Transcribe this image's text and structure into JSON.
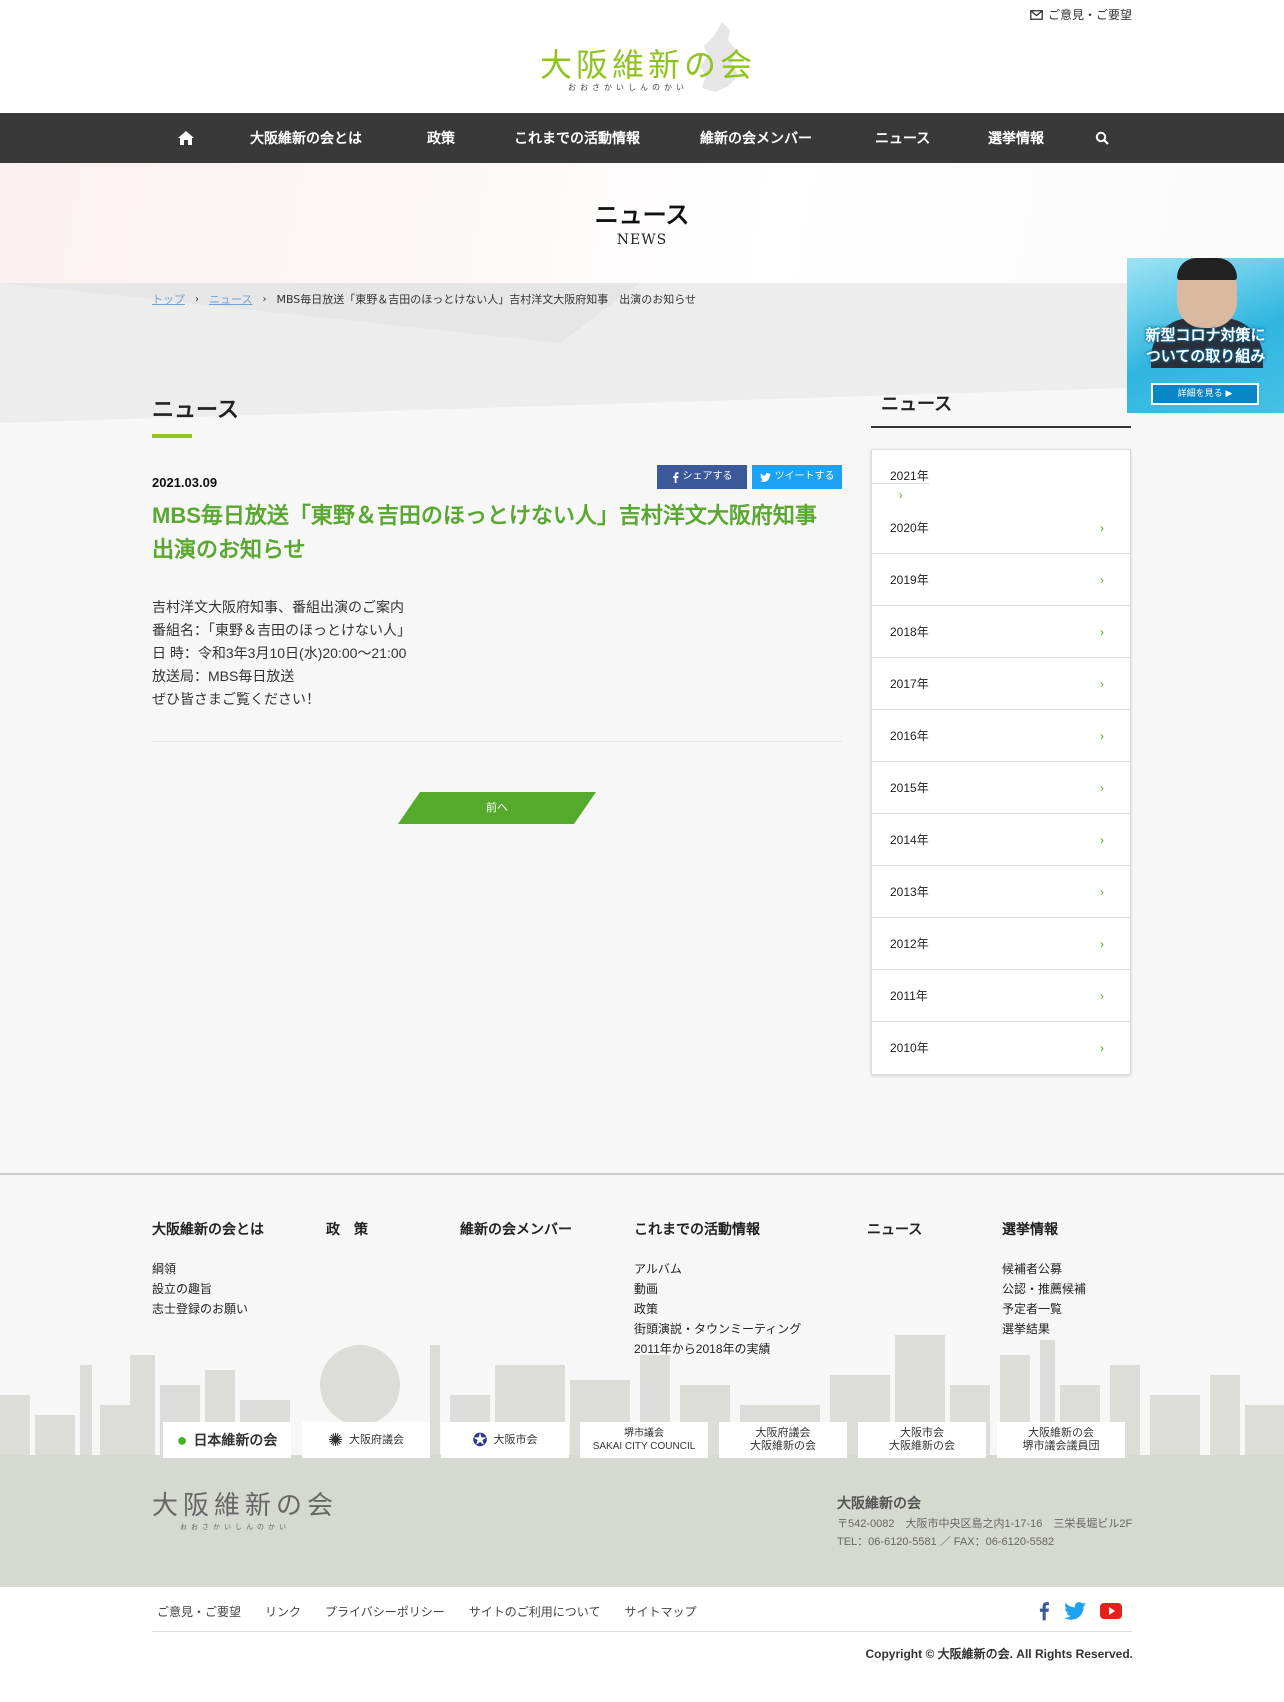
{
  "header": {
    "logo_text": "大阪維新の会",
    "logo_sub": "おおさかいしんのかい",
    "contact_label": "ご意見・ご要望"
  },
  "nav": {
    "items": [
      "大阪維新の会とは",
      "政策",
      "これまでの活動情報",
      "維新の会メンバー",
      "ニュース",
      "選挙情報"
    ]
  },
  "page": {
    "title": "ニュース",
    "subtitle": "NEWS"
  },
  "breadcrumb": [
    "トップ",
    "ニュース",
    "MBS毎日放送「東野＆吉田のほっとけない人」吉村洋文大阪府知事　出演のお知らせ"
  ],
  "main": {
    "heading": "ニュース",
    "date": "2021.03.09",
    "share_fb": "シェアする",
    "share_tw": "ツイートする",
    "title": "MBS毎日放送「東野＆吉田のほっとけない人」吉村洋文大阪府知事　出演のお知らせ",
    "body": [
      "吉村洋文大阪府知事、番組出演のご案内",
      "番組名：「東野＆吉田のほっとけない人」",
      "日 時：令和3年3月10日(水)20:00～21:00",
      "放送局：MBS毎日放送",
      "ぜひ皆さまご覧ください！"
    ],
    "prev_label": "前へ"
  },
  "sidebar": {
    "heading": "ニュース",
    "years": [
      "2021年",
      "2020年",
      "2019年",
      "2018年",
      "2017年",
      "2016年",
      "2015年",
      "2014年",
      "2013年",
      "2012年",
      "2011年",
      "2010年"
    ]
  },
  "corona_banner": {
    "line1": "新型コロナ対策に",
    "line2": "ついての取り組み",
    "button": "詳細を見る"
  },
  "footer": {
    "columns": [
      {
        "heading": "大阪維新の会とは",
        "items": [
          "綱領",
          "設立の趣旨",
          "志士登録のお願い"
        ]
      },
      {
        "heading": "政　策",
        "items": []
      },
      {
        "heading": "維新の会メンバー",
        "items": []
      },
      {
        "heading": "これまでの活動情報",
        "items": [
          "アルバム",
          "動画",
          "政策",
          "街頭演説・タウンミーティング",
          "2011年から2018年の実績"
        ]
      },
      {
        "heading": "ニュース",
        "items": []
      },
      {
        "heading": "選挙情報",
        "items": [
          "候補者公募",
          "公認・推薦候補",
          "予定者一覧",
          "選挙結果"
        ]
      }
    ],
    "partners": [
      "日本維新の会",
      "大阪府議会",
      "大阪市会",
      "堺市議会\nSAKAI CITY COUNCIL",
      "大阪府議会\n大阪維新の会",
      "大阪市会\n大阪維新の会",
      "大阪維新の会\n堺市議会議員団"
    ],
    "logo_text": "大阪維新の会",
    "logo_sub": "おおさかいしんのかい",
    "org_name": "大阪維新の会",
    "address": "〒542-0082　大阪市中央区島之内1-17-16　三栄長堀ビル2F",
    "tel_fax": "TEL：06-6120-5581 ／ FAX：06-6120-5582",
    "bottom_links": [
      "ご意見・ご要望",
      "リンク",
      "プライバシーポリシー",
      "サイトのご利用について",
      "サイトマップ"
    ],
    "copyright": "Copyright © 大阪維新の会. All Rights Reserved."
  },
  "colors": {
    "brand_green": "#8fc31f",
    "title_green": "#5aa732",
    "nav_bg": "#393939",
    "facebook": "#3b5998",
    "twitter": "#1da1f2",
    "youtube": "#e62117"
  }
}
